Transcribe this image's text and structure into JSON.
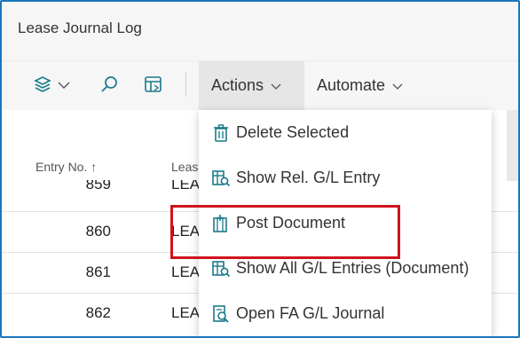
{
  "window": {
    "title": "Lease Journal Log"
  },
  "toolbar": {
    "actions_label": "Actions",
    "automate_label": "Automate"
  },
  "columns": {
    "entry_no": "Entry No. ↑",
    "lease": "Leas"
  },
  "rows": [
    {
      "entry_no": "859",
      "lease": "LEA"
    },
    {
      "entry_no": "860",
      "lease": "LEA"
    },
    {
      "entry_no": "861",
      "lease": "LEA"
    },
    {
      "entry_no": "862",
      "lease": "LEA"
    }
  ],
  "actions_menu": {
    "items": [
      {
        "label": "Delete Selected",
        "icon": "trash-icon"
      },
      {
        "label": "Show Rel. G/L Entry",
        "icon": "ledger-search-icon"
      },
      {
        "label": "Post Document",
        "icon": "post-document-icon"
      },
      {
        "label": "Show All G/L Entries (Document)",
        "icon": "ledger-search-icon"
      },
      {
        "label": "Open FA G/L Journal",
        "icon": "journal-search-icon"
      }
    ]
  },
  "colors": {
    "accent": "#1b75bb",
    "highlight": "#d0121b",
    "icon_teal": "#1a7a8a"
  }
}
